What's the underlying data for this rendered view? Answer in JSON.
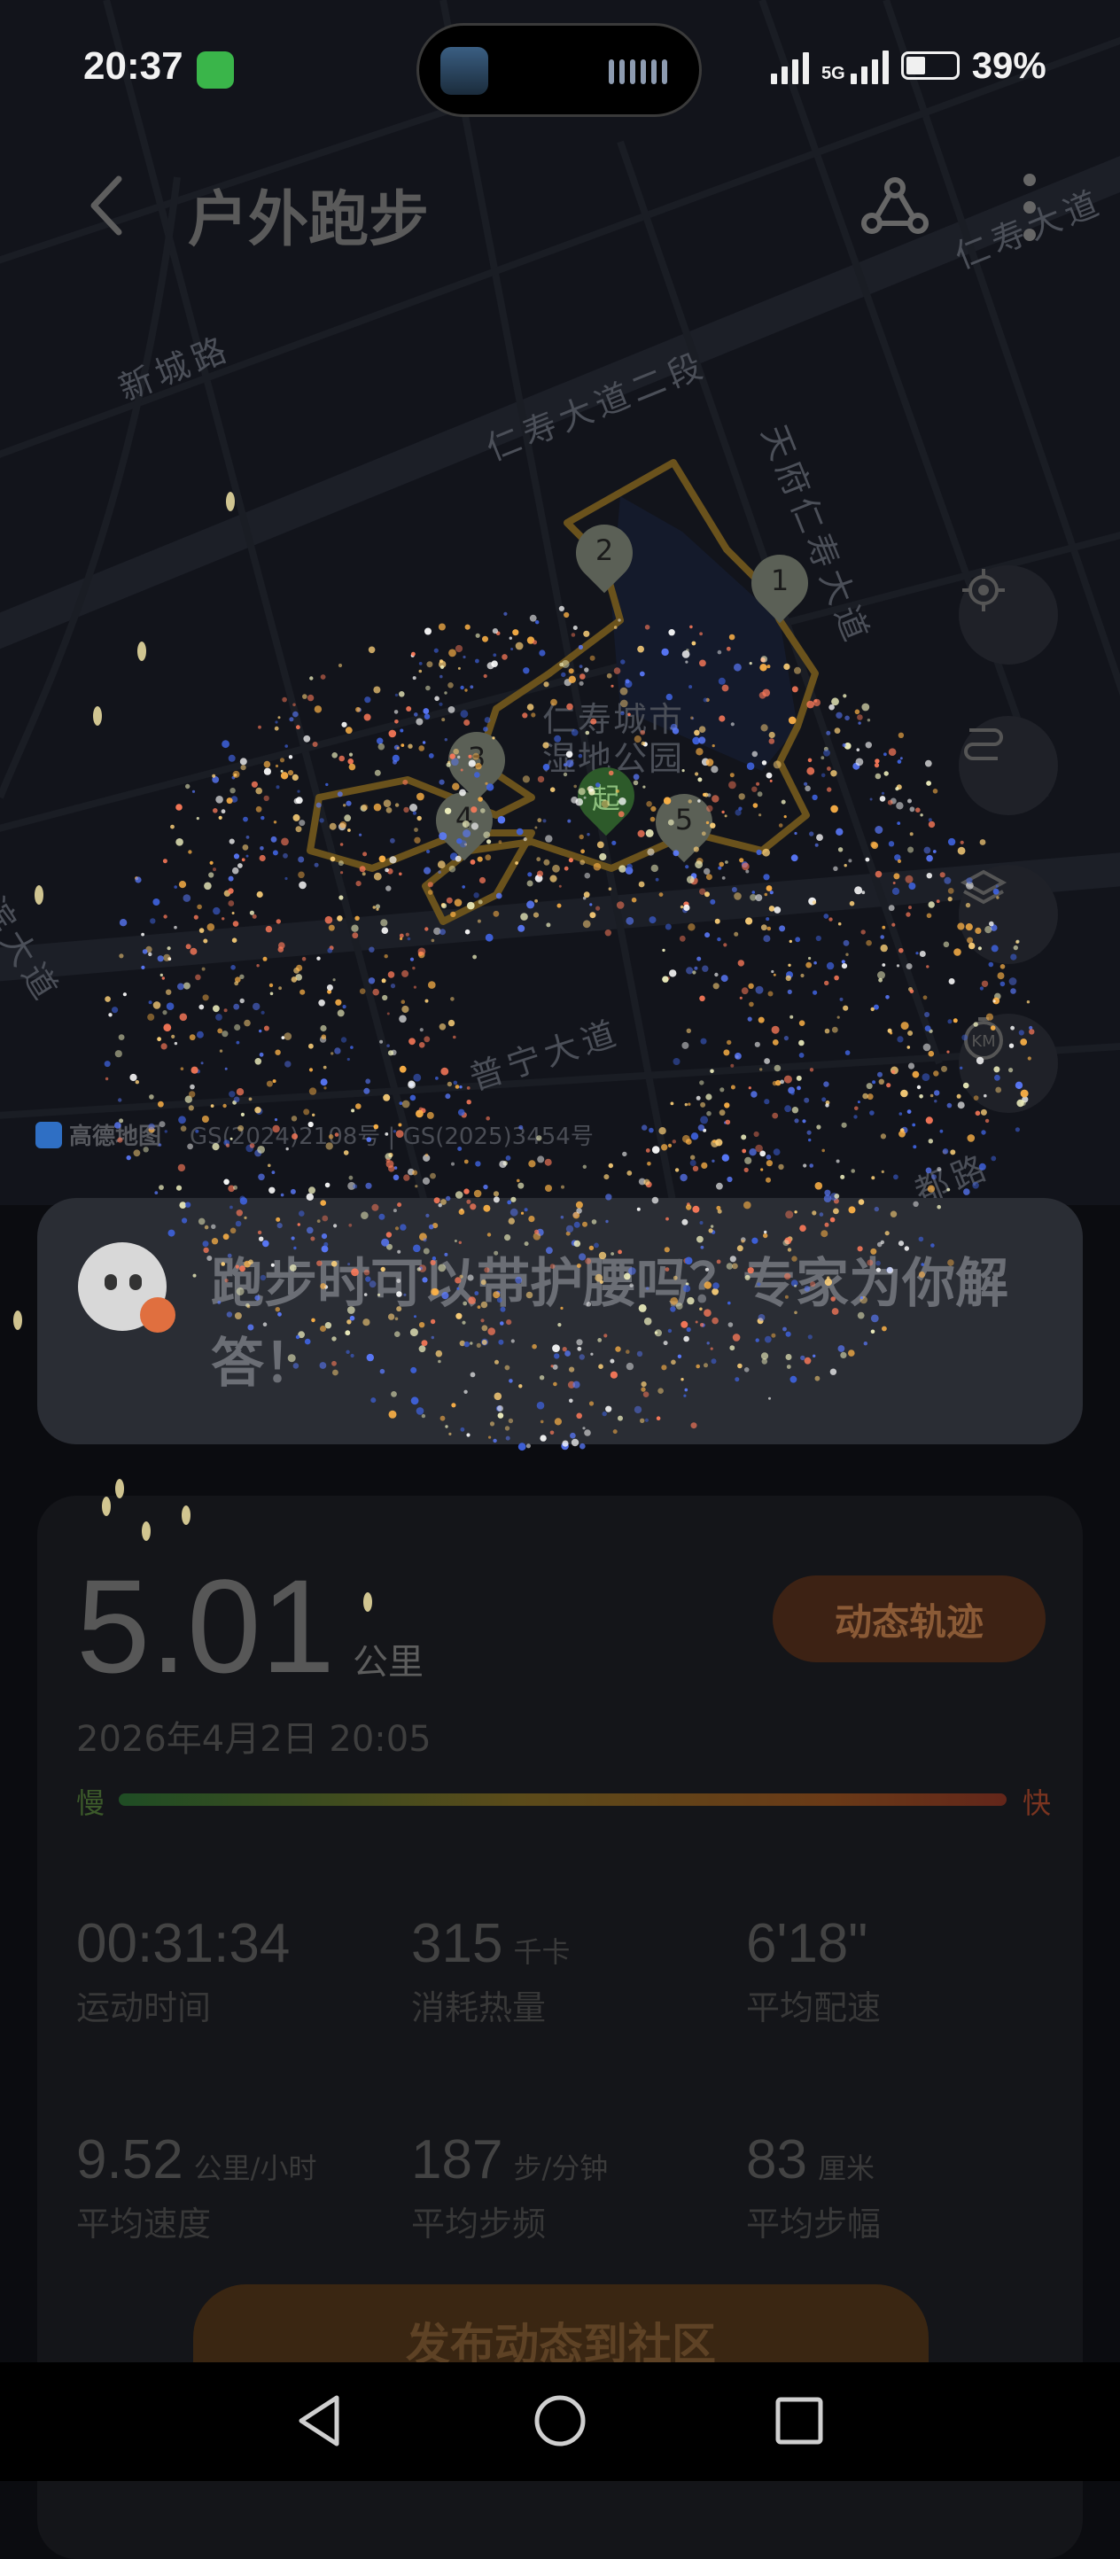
{
  "status_bar": {
    "time": "20:37",
    "network": "5G",
    "battery_percent": "39%",
    "battery_level": 0.39
  },
  "header": {
    "title": "户外跑步"
  },
  "map": {
    "road_labels": [
      "新城路",
      "仁寿大道二段",
      "天府仁寿大道",
      "仁寿大道",
      "普宁大道",
      "仁寿城市湿地公园",
      "都路",
      "滨大道"
    ],
    "credit_logo": "高德地图",
    "credit_text": "GS(2024)2108号 | GS(2025)3454号",
    "markers": [
      "1",
      "2",
      "3",
      "4",
      "5"
    ],
    "start_label": "起",
    "route_color": "#8a6a22"
  },
  "notice": {
    "text": "跑步时可以带护腰吗？专家为你解答！"
  },
  "stats": {
    "distance": "5.01",
    "distance_unit": "公里",
    "dynamic_button": "动态轨迹",
    "date": "2026年4月2日 20:05",
    "slow_label": "慢",
    "fast_label": "快",
    "metrics": [
      {
        "value": "00:31:34",
        "unit": "",
        "label": "运动时间"
      },
      {
        "value": "315",
        "unit": "千卡",
        "label": "消耗热量"
      },
      {
        "value": "6'18\"",
        "unit": "",
        "label": "平均配速"
      },
      {
        "value": "9.52",
        "unit": "公里/小时",
        "label": "平均速度"
      },
      {
        "value": "187",
        "unit": "步/分钟",
        "label": "平均步频"
      },
      {
        "value": "83",
        "unit": "厘米",
        "label": "平均步幅"
      }
    ],
    "publish_button": "发布动态到社区"
  },
  "icons": {
    "back": "chevron-left-icon",
    "route": "route-share-icon",
    "more": "more-vertical-icon",
    "locate": "locate-icon",
    "route_toggle": "route-toggle-icon",
    "layers": "layers-icon",
    "km": "km-marker-icon"
  },
  "colors": {
    "accent": "#e07a3a",
    "background": "#0b0c10"
  }
}
